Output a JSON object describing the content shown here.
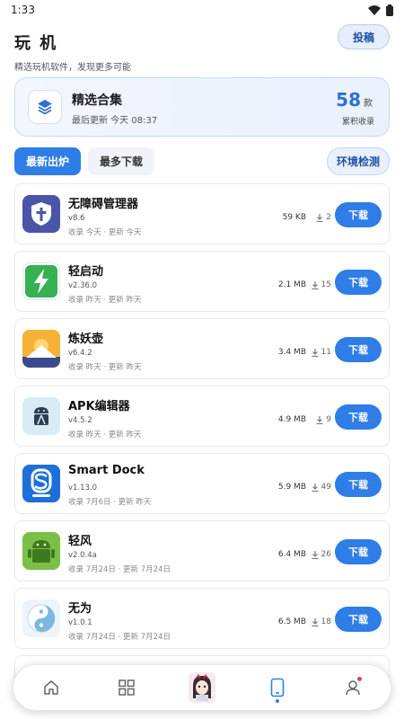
{
  "status_bar": {
    "time": "1:33"
  },
  "header": {
    "title": "玩 机",
    "subtitle": "精选玩机软件，发现更多可能",
    "submit_label": "投稿"
  },
  "collection": {
    "title": "精选合集",
    "updated": "最后更新 今天 08:37",
    "count": "58",
    "unit": "款",
    "count_label": "累积收录"
  },
  "tabs": {
    "latest": "最新出炉",
    "most": "最多下载",
    "env_check": "环境检测"
  },
  "download_label": "下载",
  "apps": [
    {
      "name": "无障碍管理器",
      "version": "v8.6",
      "dates": "收录 今天 · 更新 今天",
      "size": "59 KB",
      "downloads": "2",
      "icon": "shield-cross-icon",
      "color": "#4a55a8"
    },
    {
      "name": "轻启动",
      "version": "v2.36.0",
      "dates": "收录 昨天 · 更新 昨天",
      "size": "2.1 MB",
      "downloads": "15",
      "icon": "lightning-icon",
      "color": "#35b052"
    },
    {
      "name": "炼妖壶",
      "version": "v6.4.2",
      "dates": "收录 昨天 · 更新 昨天",
      "size": "3.4 MB",
      "downloads": "11",
      "icon": "mountain-sun-icon",
      "color": "#f2a21b"
    },
    {
      "name": "APK编辑器",
      "version": "v4.5.2",
      "dates": "收录 昨天 · 更新 昨天",
      "size": "4.9 MB",
      "downloads": "9",
      "icon": "android-robot-icon",
      "color": "#d7ecf7"
    },
    {
      "name": "Smart Dock",
      "version": "v1.13.0",
      "dates": "收录 7月6日 · 更新 昨天",
      "size": "5.9 MB",
      "downloads": "49",
      "icon": "dock-s-icon",
      "color": "#1e6fd9"
    },
    {
      "name": "轻风",
      "version": "v2.0.4a",
      "dates": "收录 7月24日 · 更新 7月24日",
      "size": "6.4 MB",
      "downloads": "26",
      "icon": "android-robot-icon",
      "color": "#6db33f"
    },
    {
      "name": "无为",
      "version": "v1.0.1",
      "dates": "收录 7月24日 · 更新 7月24日",
      "size": "6.5 MB",
      "downloads": "18",
      "icon": "yin-yang-icon",
      "color": "#e9f1f7"
    }
  ],
  "bottom_nav": [
    {
      "name": "home",
      "icon": "home-icon"
    },
    {
      "name": "apps",
      "icon": "grid-icon"
    },
    {
      "name": "avatar",
      "icon": "anime-avatar-icon"
    },
    {
      "name": "phone",
      "icon": "phone-icon",
      "active": true
    },
    {
      "name": "profile",
      "icon": "user-icon",
      "badge": true
    }
  ]
}
